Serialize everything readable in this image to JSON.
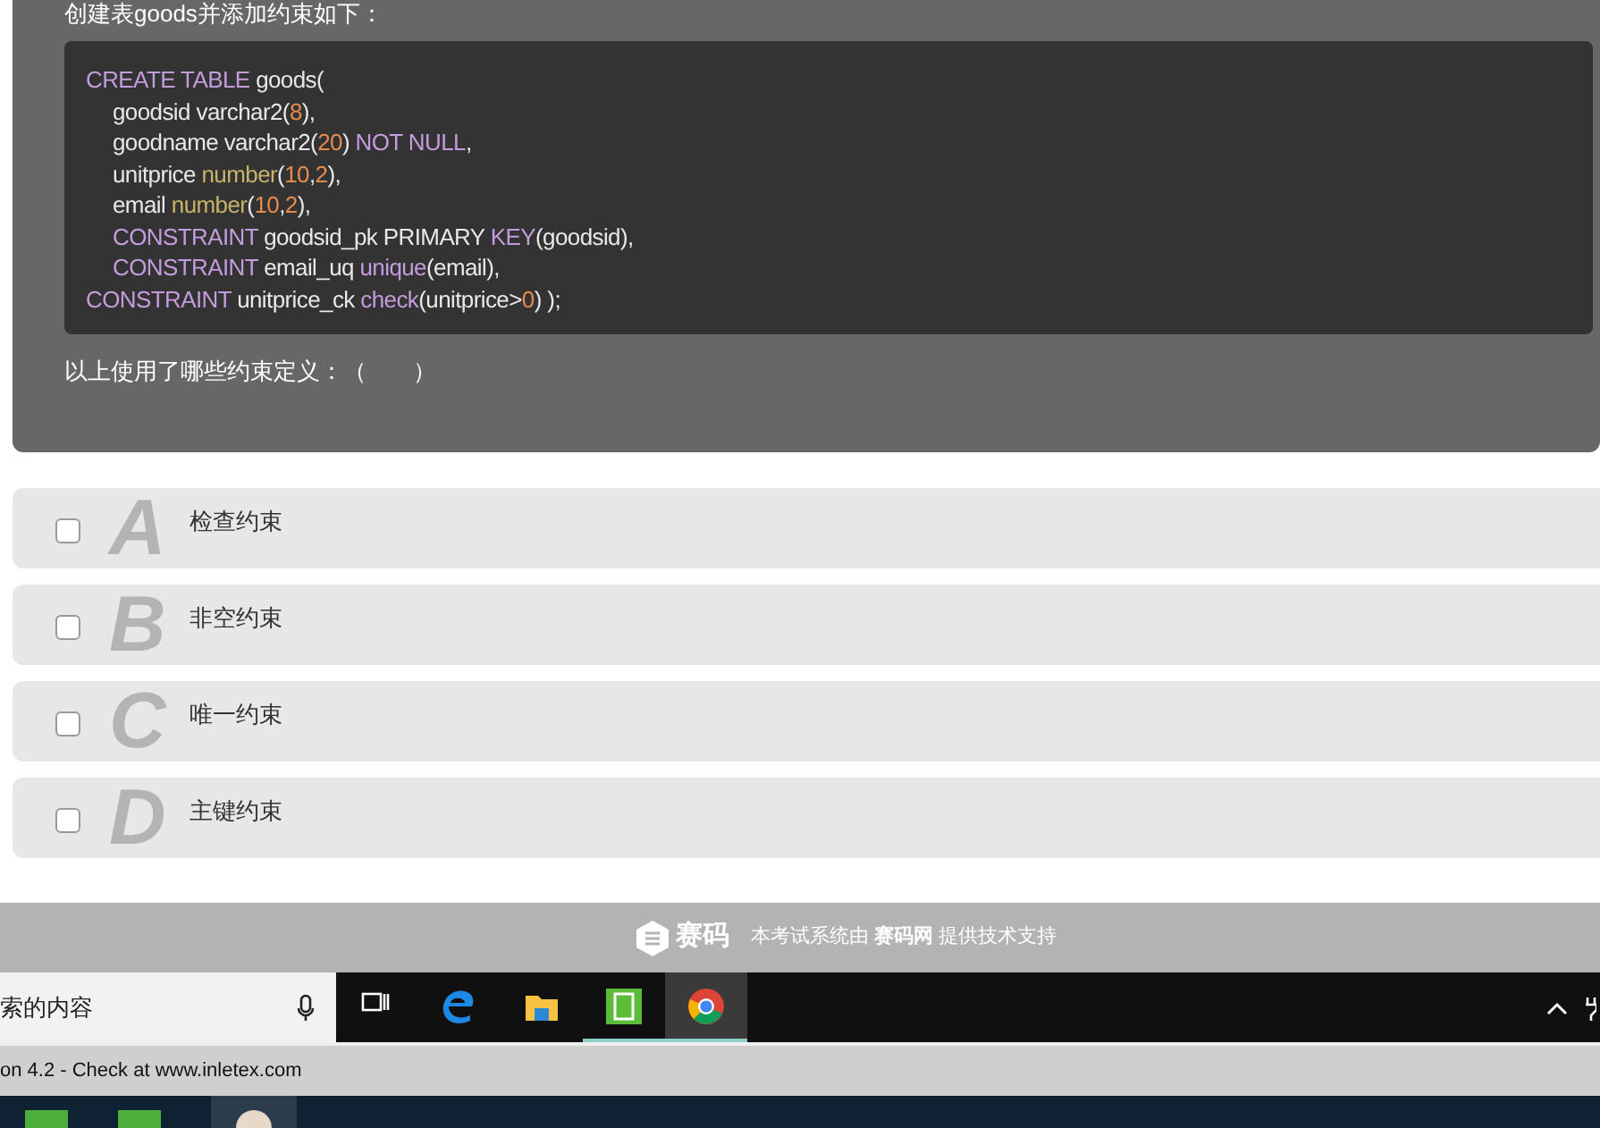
{
  "question": {
    "intro": "创建表goods并添加约束如下：",
    "code_lines": [
      {
        "indented": false,
        "tokens": [
          {
            "kind": "keyword",
            "text": "CREATE TABLE"
          },
          {
            "kind": "plain",
            "text": " goods("
          }
        ]
      },
      {
        "indented": true,
        "tokens": [
          {
            "kind": "plain",
            "text": "goodsid varchar2("
          },
          {
            "kind": "number",
            "text": "8"
          },
          {
            "kind": "plain",
            "text": "),"
          }
        ]
      },
      {
        "indented": true,
        "tokens": [
          {
            "kind": "plain",
            "text": "goodname varchar2("
          },
          {
            "kind": "number",
            "text": "20"
          },
          {
            "kind": "plain",
            "text": ") "
          },
          {
            "kind": "keyword",
            "text": "NOT NULL"
          },
          {
            "kind": "plain",
            "text": ","
          }
        ]
      },
      {
        "indented": true,
        "tokens": [
          {
            "kind": "plain",
            "text": "unitprice "
          },
          {
            "kind": "type",
            "text": "number"
          },
          {
            "kind": "plain",
            "text": "("
          },
          {
            "kind": "number",
            "text": "10"
          },
          {
            "kind": "plain",
            "text": ","
          },
          {
            "kind": "number",
            "text": "2"
          },
          {
            "kind": "plain",
            "text": "),"
          }
        ]
      },
      {
        "indented": true,
        "tokens": [
          {
            "kind": "plain",
            "text": "email "
          },
          {
            "kind": "type",
            "text": "number"
          },
          {
            "kind": "plain",
            "text": "("
          },
          {
            "kind": "number",
            "text": "10"
          },
          {
            "kind": "plain",
            "text": ","
          },
          {
            "kind": "number",
            "text": "2"
          },
          {
            "kind": "plain",
            "text": "),"
          }
        ]
      },
      {
        "indented": true,
        "tokens": [
          {
            "kind": "keyword",
            "text": "CONSTRAINT"
          },
          {
            "kind": "plain",
            "text": " goodsid_pk PRIMARY "
          },
          {
            "kind": "keyword",
            "text": "KEY"
          },
          {
            "kind": "plain",
            "text": "(goodsid),"
          }
        ]
      },
      {
        "indented": true,
        "tokens": [
          {
            "kind": "keyword",
            "text": "CONSTRAINT"
          },
          {
            "kind": "plain",
            "text": " email_uq "
          },
          {
            "kind": "keyword",
            "text": "unique"
          },
          {
            "kind": "plain",
            "text": "(email),"
          }
        ]
      },
      {
        "indented": false,
        "tokens": [
          {
            "kind": "keyword",
            "text": "CONSTRAINT"
          },
          {
            "kind": "plain",
            "text": " unitprice_ck "
          },
          {
            "kind": "keyword",
            "text": "check"
          },
          {
            "kind": "plain",
            "text": "(unitprice>"
          },
          {
            "kind": "number",
            "text": "0"
          },
          {
            "kind": "plain",
            "text": ") );"
          }
        ]
      }
    ],
    "prompt": "以上使用了哪些约束定义：（　　）"
  },
  "options": [
    {
      "letter": "A",
      "text": "检查约束",
      "checked": false
    },
    {
      "letter": "B",
      "text": "非空约束",
      "checked": false
    },
    {
      "letter": "C",
      "text": "唯一约束",
      "checked": false
    },
    {
      "letter": "D",
      "text": "主键约束",
      "checked": false
    }
  ],
  "footer": {
    "logo_text": "赛码",
    "support_text": "本考试系统由 **赛码网** 提供技术支持"
  },
  "taskbar": {
    "search_text": "索的内容",
    "apps": [
      {
        "kind": "taskview",
        "selected": false
      },
      {
        "kind": "edge",
        "selected": false
      },
      {
        "kind": "folder",
        "selected": false
      },
      {
        "kind": "green",
        "selected": true
      },
      {
        "kind": "chrome",
        "selected": true
      }
    ]
  },
  "status_bar": {
    "text": "on 4.2 - Check at www.inletex.com"
  }
}
